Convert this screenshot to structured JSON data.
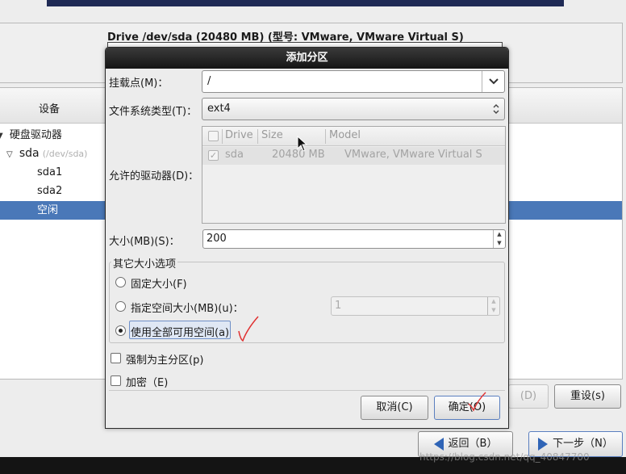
{
  "background": {
    "drive_title": "Drive /dev/sda (20480 MB) (型号: VMware, VMware Virtual S)",
    "tree": {
      "header_device": "设备",
      "items": [
        {
          "label": "硬盘驱动器",
          "sub": ""
        },
        {
          "label": "sda",
          "sub": "(/dev/sda)"
        },
        {
          "label": "sda1",
          "sub": ""
        },
        {
          "label": "sda2",
          "sub": ""
        },
        {
          "label": "空闲",
          "sub": ""
        }
      ]
    },
    "buttons": {
      "delete": "(D)",
      "reset": "重设(s)"
    },
    "nav": {
      "back": "返回（B）",
      "next": "下一步（N）"
    },
    "watermark": "https://blog.csdn.net/qq_40847700"
  },
  "dialog": {
    "title": "添加分区",
    "mount_point": {
      "label": "挂载点(M)：",
      "value": "/"
    },
    "fs_type": {
      "label": "文件系统类型(T)：",
      "value": "ext4"
    },
    "allowed_drives": {
      "label": "允许的驱动器(D)：",
      "columns": [
        "Drive",
        "Size",
        "Model"
      ],
      "rows": [
        {
          "checked": true,
          "drive": "sda",
          "size": "20480 MB",
          "model": "VMware, VMware Virtual S"
        }
      ]
    },
    "size": {
      "label": "大小(MB)(S)：",
      "value": "200"
    },
    "other_size_options": {
      "legend": "其它大小选项",
      "fixed": "固定大小(F)",
      "fill_to": "指定空间大小(MB)(u)：",
      "fill_to_value": "1",
      "fill_all": "使用全部可用空间(a)",
      "selected": "fill_all"
    },
    "force_primary": {
      "label": "强制为主分区(p)",
      "checked": false
    },
    "encrypt": {
      "label": "加密（E)",
      "checked": false
    },
    "cancel": "取消(C)",
    "ok": "确定(O)"
  },
  "colors": {
    "accent_selection": "#4a78b8",
    "dialog_title_bg": "#1e1e1e",
    "annotation_red": "#e03030"
  }
}
